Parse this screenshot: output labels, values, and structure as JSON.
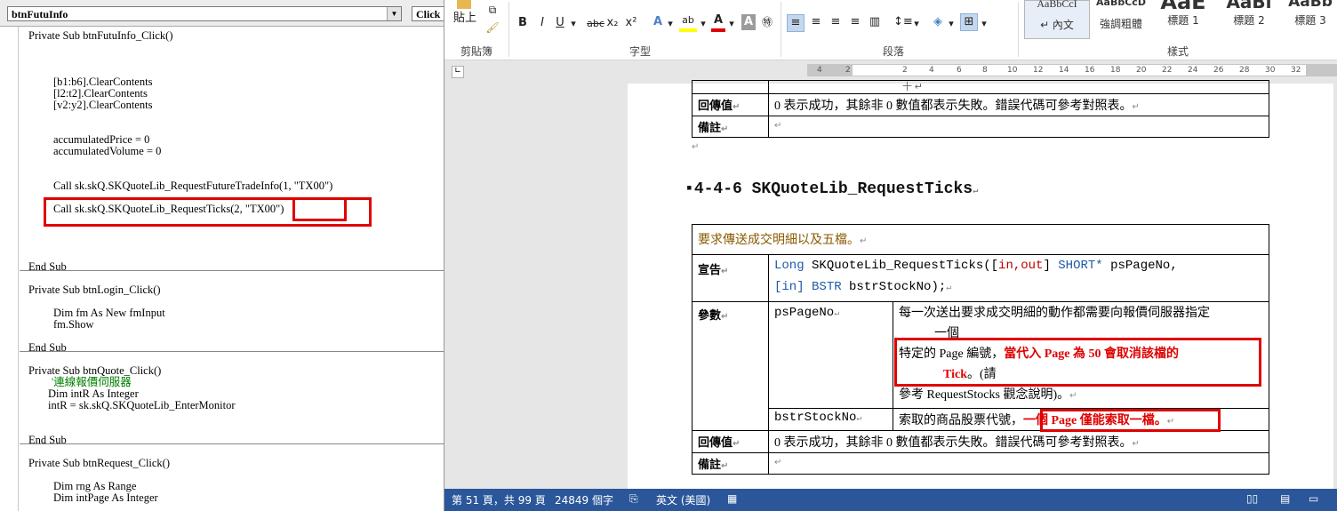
{
  "vba": {
    "object_combo": "btnFutuInfo",
    "proc_combo": "Click",
    "lines": [
      "Private Sub btnFutuInfo_Click()",
      "[b1:b6].ClearContents",
      "[l2:t2].ClearContents",
      "[v2:y2].ClearContents",
      "accumulatedPrice = 0",
      "accumulatedVolume = 0",
      "Call sk.skQ.SKQuoteLib_RequestFutureTradeInfo(1, \"TX00\")",
      "Call sk.skQ.SKQuoteLib_RequestTicks(2, \"TX00\")",
      "End Sub",
      "Private Sub btnLogin_Click()",
      "Dim fm As New fmInput",
      "fm.Show",
      "End Sub",
      "Private Sub btnQuote_Click()",
      "'連線報價伺服器",
      "Dim intR As Integer",
      "intR = sk.skQ.SKQuoteLib_EnterMonitor",
      "End Sub",
      "Private Sub btnRequest_Click()",
      "Dim rng As Range",
      "Dim intPage As Integer"
    ]
  },
  "ribbon": {
    "paste_label": "貼上",
    "clipboard_label": "剪貼簿",
    "font_label": "字型",
    "paragraph_label": "段落",
    "styles_label": "樣式",
    "font_buttons": [
      "B",
      "I",
      "U",
      "abc",
      "x₂",
      "x²"
    ],
    "styles": [
      {
        "preview": "AaBbCcI",
        "name": "↵ 內文"
      },
      {
        "preview": "AaBbCcD",
        "name": "強調粗體"
      },
      {
        "preview": "AaE",
        "name": "標題 1"
      },
      {
        "preview": "AaBl",
        "name": "標題 2"
      },
      {
        "preview": "AaBb",
        "name": "標題 3"
      }
    ]
  },
  "ruler": [
    "4",
    "2",
    "",
    "2",
    "4",
    "6",
    "8",
    "10",
    "12",
    "14",
    "16",
    "18",
    "20",
    "22",
    "24",
    "26",
    "28",
    "30",
    "32"
  ],
  "doc": {
    "top_table": {
      "partial": "十 ↵",
      "return_label": "回傳值",
      "return_text": "0 表示成功，其餘非 0 數值都表示失敗。錯誤代碼可參考對照表。",
      "note_label": "備註"
    },
    "heading": "4-4-6 SKQuoteLib_RequestTicks",
    "table": {
      "desc": "要求傳送成交明細以及五檔。",
      "decl_label": "宣告",
      "decl_long": "Long",
      "decl_fn": " SKQuoteLib_RequestTicks([",
      "decl_in": "in,out",
      "decl_mid": "]",
      "decl_short": "SHORT*",
      "decl_p1": " psPageNo,",
      "decl_in2": "[in]",
      "decl_bstr": "BSTR",
      "decl_p2": " bstrStockNo);",
      "param_label": "參數",
      "p1_name": "psPageNo",
      "p1_line1": "每一次送出要求成交明細的動作都需要向報價伺服器指定",
      "p1_line1b": "一個",
      "p1_line2a": "特定的 Page 編號，",
      "p1_line2b": "當代入 Page 為 50 會取消該檔的",
      "p1_line2c": "Tick",
      "p1_line2d": "。(請",
      "p1_line3": "參考 RequestStocks 觀念說明)。",
      "p2_name": "bstrStockNo",
      "p2_text_a": "索取的商品股票代號，",
      "p2_text_b": "一個 Page 僅能索取一檔。",
      "return_label": "回傳值",
      "return_text": "0 表示成功，其餘非 0 數值都表示失敗。錯誤代碼可參考對照表。",
      "note_label": "備註"
    }
  },
  "status": {
    "page": "第 51 頁，共 99 頁",
    "words": "24849 個字",
    "lang": "英文 (美國)"
  }
}
